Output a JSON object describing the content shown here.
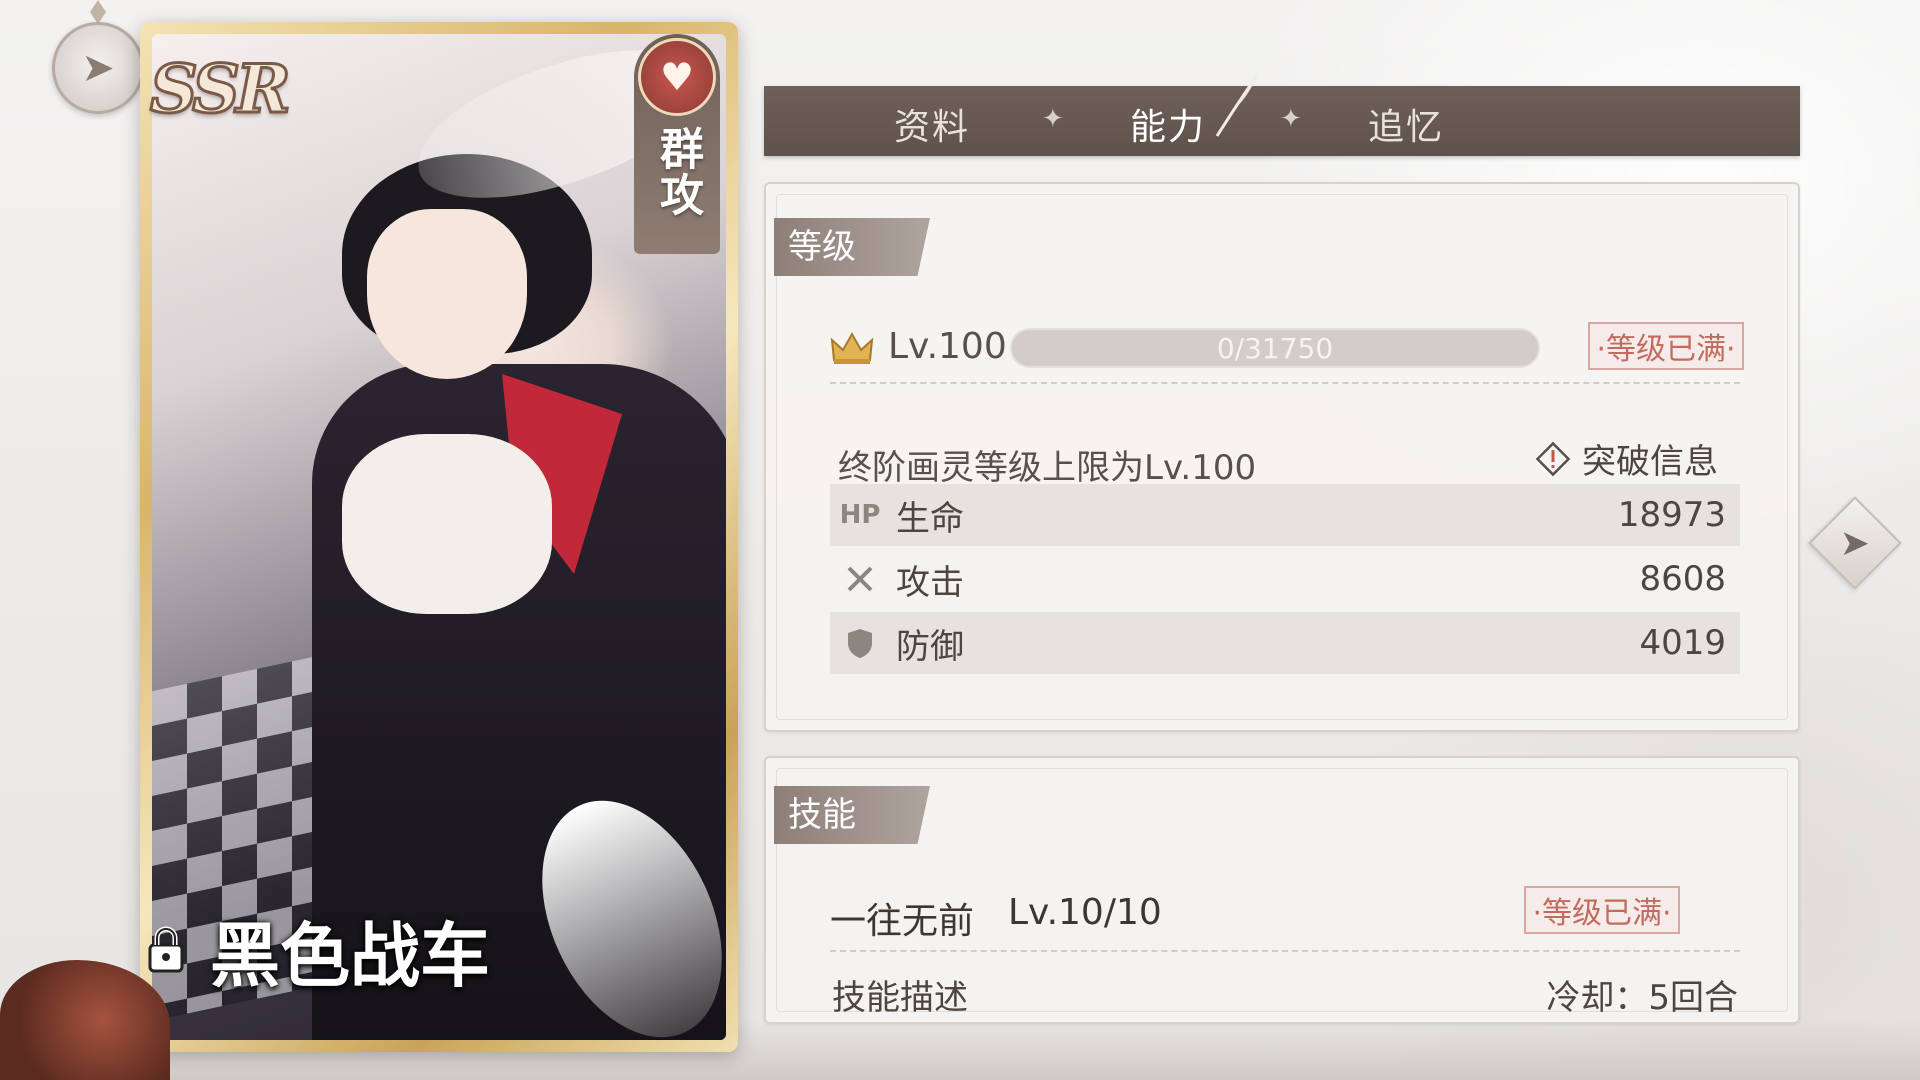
{
  "card": {
    "rarity": "SSR",
    "attack_type": "群攻",
    "name": "黑色战车",
    "icons": {
      "heart": "heart-beat-icon",
      "lock": "lock-icon"
    }
  },
  "tabs": [
    {
      "label": "资料",
      "active": false
    },
    {
      "label": "能力",
      "active": true
    },
    {
      "label": "追忆",
      "active": false
    }
  ],
  "level_section": {
    "title": "等级",
    "level_label": "Lv.100",
    "xp_text": "0/31750",
    "max_badge": "·等级已满·",
    "limit_text": "终阶画灵等级上限为Lv.100",
    "breakthrough_label": "突破信息",
    "stats": [
      {
        "icon": "HP",
        "label": "生命",
        "value": "18973"
      },
      {
        "icon": "swords-icon",
        "label": "攻击",
        "value": "8608"
      },
      {
        "icon": "shield-icon",
        "label": "防御",
        "value": "4019"
      }
    ]
  },
  "skill_section": {
    "title": "技能",
    "skill_name": "一往无前",
    "skill_level": "Lv.10/10",
    "max_badge": "·等级已满·",
    "desc_label": "技能描述",
    "cooldown": "冷却：5回合"
  },
  "colors": {
    "accent": "#c46b5f",
    "tab_bar": "#6e6058",
    "gold": "#d9b56a"
  }
}
